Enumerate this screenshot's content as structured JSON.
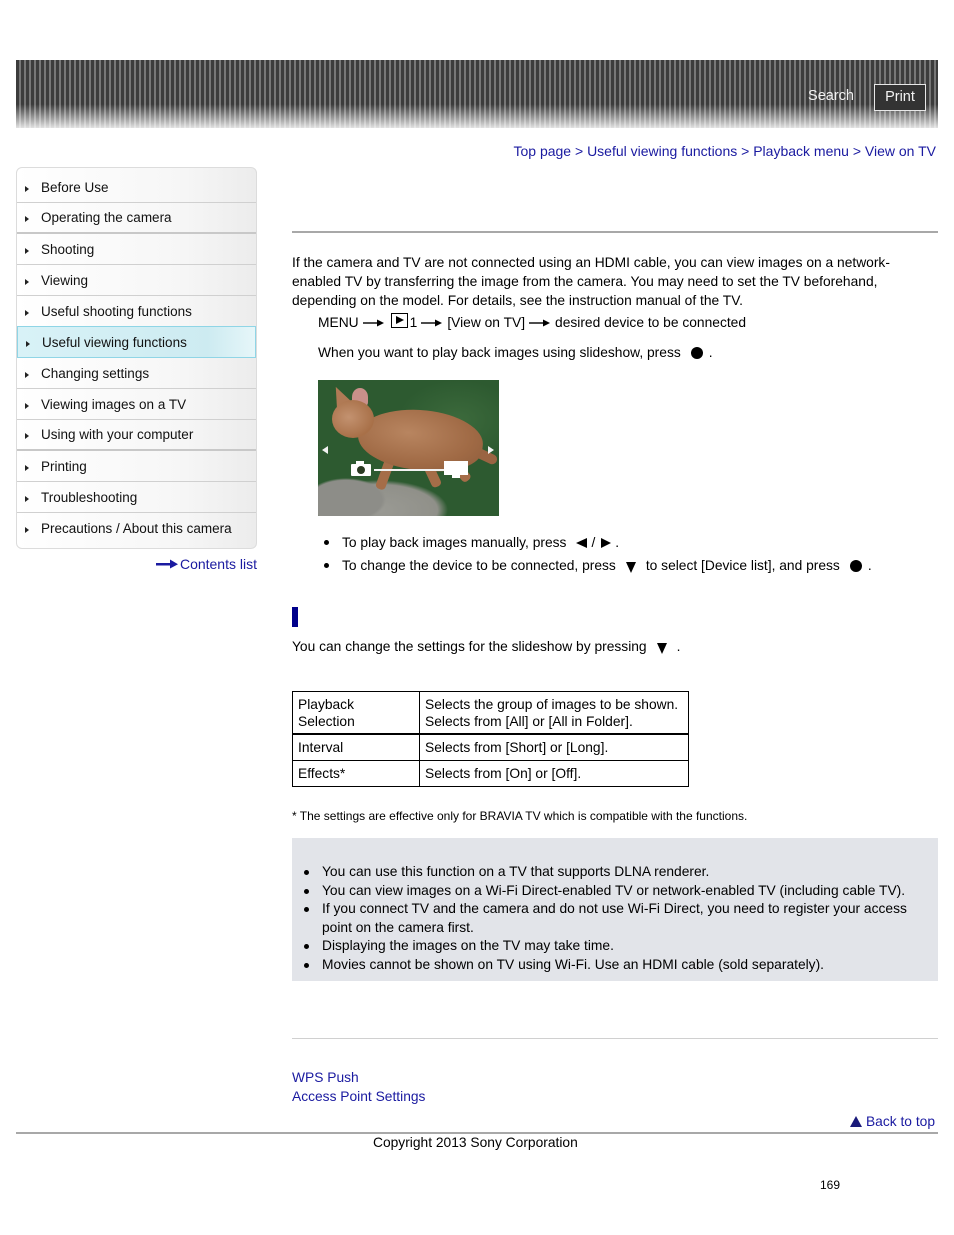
{
  "header": {
    "search_label": "Search",
    "print_label": "Print"
  },
  "breadcrumb": {
    "items": [
      "Top page",
      "Useful viewing functions",
      "Playback menu",
      "View on TV"
    ],
    "separator": ">"
  },
  "sidebar": {
    "items": [
      {
        "label": "Before Use",
        "active": false
      },
      {
        "label": "Operating the camera",
        "active": false
      },
      {
        "label": "Shooting",
        "active": false
      },
      {
        "label": "Viewing",
        "active": false
      },
      {
        "label": "Useful shooting functions",
        "active": false
      },
      {
        "label": "Useful viewing functions",
        "active": true
      },
      {
        "label": "Changing settings",
        "active": false
      },
      {
        "label": "Viewing images on a TV",
        "active": false
      },
      {
        "label": "Using with your computer",
        "active": false
      },
      {
        "label": "Printing",
        "active": false
      },
      {
        "label": "Troubleshooting",
        "active": false
      },
      {
        "label": "Precautions / About this camera",
        "active": false
      }
    ],
    "contents_list_label": "Contents list"
  },
  "main": {
    "intro": "If the camera and TV are not connected using an HDMI cable, you can view images on a network-enabled TV by transferring the image from the camera. You may need to set the TV beforehand, depending on the model. For details, see the instruction manual of the TV.",
    "step": {
      "menu": "MENU",
      "tab_number": "1",
      "item": "[View on TV]",
      "target": "desired device to be connected"
    },
    "slideshow_text": "When you want to play back images using slideshow, press",
    "slideshow_suffix": ".",
    "photo_alt": "Kitten playback screen with camera-to-TV icon",
    "bullets": [
      {
        "before": "To play back images manually, press",
        "sep": "/",
        "after": "."
      },
      {
        "before": "To change the device to be connected, press",
        "mid": "to select [Device list], and press",
        "after": "."
      }
    ],
    "section2_intro": "You can change the settings for the slideshow by pressing",
    "section2_suffix": ".",
    "settings_table": [
      {
        "name": "Playback Selection",
        "desc": "Selects the group of images to be shown. Selects from [All] or [All in Folder]."
      },
      {
        "name": "Interval",
        "desc": "Selects from [Short] or [Long]."
      },
      {
        "name": "Effects*",
        "desc": "Selects from [On] or [Off]."
      }
    ],
    "footnote": "* The settings are effective only for BRAVIA TV which is compatible with the functions.",
    "notes": [
      "You can use this function on a TV that supports DLNA renderer.",
      "You can view images on a Wi-Fi Direct-enabled TV or network-enabled TV (including cable TV).",
      "If you connect TV and the camera and do not use Wi-Fi Direct, you need to register your access point on the camera first.",
      "Displaying the images on the TV may take time.",
      "Movies cannot be shown on TV using Wi-Fi. Use an HDMI cable (sold separately)."
    ],
    "related_links": [
      "WPS Push",
      "Access Point Settings"
    ]
  },
  "footer": {
    "back_to_top": "Back to top",
    "copyright": "Copyright 2013 Sony Corporation",
    "page_number": "169"
  },
  "colors": {
    "link": "#1a1aa0",
    "section_marker": "#00008b",
    "note_bg": "#e2e4e9",
    "active_nav": "#cdebf1"
  }
}
